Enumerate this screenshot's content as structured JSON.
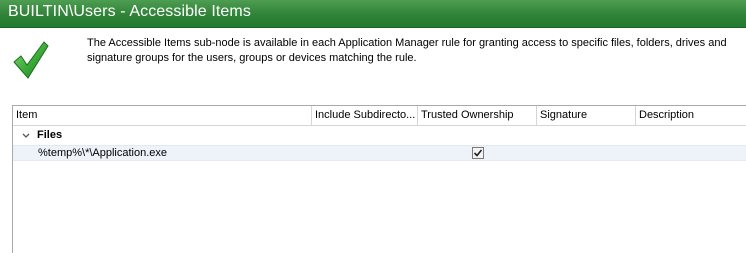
{
  "header": {
    "title": "BUILTIN\\Users - Accessible Items",
    "icon": "checkmark-icon",
    "description": "The Accessible Items sub-node is available in each Application Manager rule for granting access to specific files, folders, drives and signature groups for the users, groups or devices matching the rule."
  },
  "grid": {
    "columns": [
      "Item",
      "Include Subdirecto...",
      "Trusted Ownership",
      "Signature",
      "Description"
    ],
    "groups": [
      {
        "label": "Files",
        "expanded": true,
        "rows": [
          {
            "item": "%temp%\\*\\Application.exe",
            "include_subdirectories": false,
            "trusted_ownership": true,
            "signature": "",
            "description": ""
          }
        ]
      }
    ]
  },
  "colors": {
    "title_bar": "#2f8338",
    "title_text": "#ffffff",
    "check_icon": "#3aa83a",
    "row_selected": "#eef3fa"
  }
}
